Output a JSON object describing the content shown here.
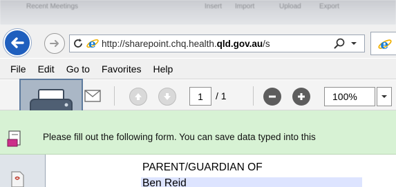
{
  "browser": {
    "url_prefix": "http://sharepoint.chq.health.",
    "url_domain": "qld.gov.au",
    "url_suffix": "/s",
    "top_strip_labels": [
      "Recent Meetings",
      "Insert",
      "Import",
      "Upload",
      "Export"
    ]
  },
  "menu": {
    "items": [
      "File",
      "Edit",
      "Go to",
      "Favorites",
      "Help"
    ]
  },
  "pdf_toolbar": {
    "page_current": "1",
    "page_total": "/ 1",
    "zoom": "100%"
  },
  "message_bar": {
    "text": "Please fill out the following form. You can save data typed into this"
  },
  "document": {
    "label": "PARENT/GUARDIAN OF",
    "field_value": "Ben Reid"
  },
  "colors": {
    "back_button": "#1f5fbe",
    "message_bar": "#d7f2d4",
    "field_highlight": "#dde4ff",
    "printer_tile": "#aab7c6"
  }
}
